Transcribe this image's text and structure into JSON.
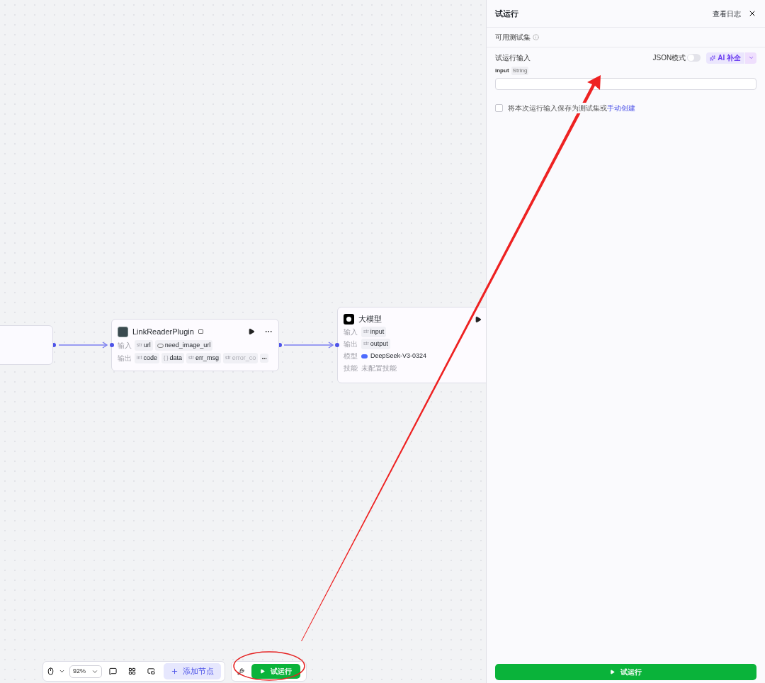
{
  "canvas": {
    "nodes": [
      {
        "kind": "blank"
      },
      {
        "kind": "plugin",
        "title": "LinkReaderPlugin",
        "rows": [
          {
            "label": "输入",
            "params": [
              {
                "kind": "string",
                "prefix": "str",
                "name": "url"
              },
              {
                "kind": "boolean",
                "name": "need_image_url"
              }
            ]
          },
          {
            "label": "输出",
            "params": [
              {
                "kind": "integer",
                "prefix": "int",
                "name": "code"
              },
              {
                "kind": "object",
                "prefix": "{ }",
                "name": "data"
              },
              {
                "kind": "string",
                "prefix": "str",
                "name": "err_msg"
              },
              {
                "kind": "string",
                "prefix": "str",
                "name": "error_co",
                "faded": true
              }
            ],
            "more": true
          }
        ]
      },
      {
        "kind": "llm",
        "title": "大模型",
        "rows": [
          {
            "kind": "params",
            "label": "输入",
            "params": [
              {
                "kind": "string",
                "prefix": "str",
                "name": "input"
              }
            ]
          },
          {
            "kind": "params",
            "label": "输出",
            "params": [
              {
                "kind": "string",
                "prefix": "str",
                "name": "output"
              }
            ]
          },
          {
            "kind": "model",
            "label": "模型",
            "value": "DeepSeek-V3-0324"
          },
          {
            "kind": "note",
            "label": "技能",
            "value": "未配置技能"
          }
        ]
      }
    ]
  },
  "toolbar": {
    "zoom": "92%",
    "add_node": "添加节点",
    "run": "试运行"
  },
  "panel": {
    "title": "试运行",
    "log_link": "查看日志",
    "test_set": "可用测试集",
    "input_title": "试运行输入",
    "json_mode": {
      "label": "JSON模式",
      "on": false
    },
    "ai_button": "AI 补全",
    "fields": [
      {
        "name": "input",
        "type": "String"
      }
    ],
    "save_option": {
      "text": "将本次运行输入保存为测试集或",
      "link": "手动创建",
      "checked": false
    },
    "run_button": "试运行"
  }
}
